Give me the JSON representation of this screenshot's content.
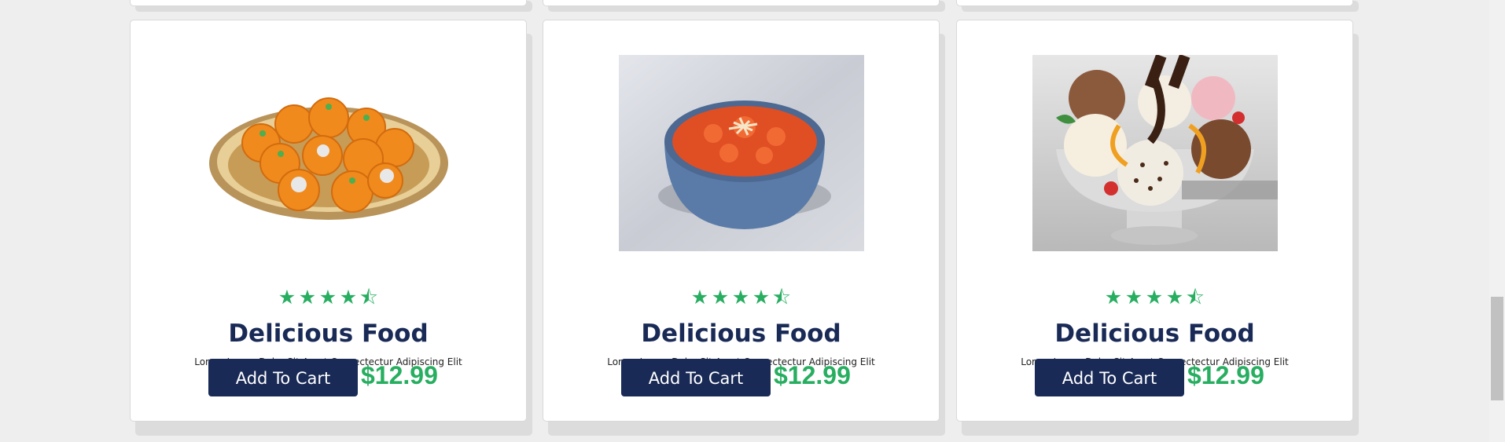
{
  "products": [
    {
      "image_icon": "laddu-plate-image",
      "rating": 4.5,
      "title": "Delicious Food",
      "description": "Lorem Ipsum Dolor Sit Amet Consectectur Adipiscing Elit",
      "button_label": "Add To Cart",
      "price": "$12.99"
    },
    {
      "image_icon": "carrot-halwa-bowl-image",
      "rating": 4.5,
      "title": "Delicious Food",
      "description": "Lorem Ipsum Dolor Sit Amet Consectectur Adipiscing Elit",
      "button_label": "Add To Cart",
      "price": "$12.99"
    },
    {
      "image_icon": "ice-cream-sundae-image",
      "rating": 4.5,
      "title": "Delicious Food",
      "description": "Lorem Ipsum Dolor Sit Amet Consectectur Adipiscing Elit",
      "button_label": "Add To Cart",
      "price": "$12.99"
    }
  ],
  "colors": {
    "accent_green": "#27ae60",
    "navy": "#192a56",
    "background": "#eeeeee"
  }
}
